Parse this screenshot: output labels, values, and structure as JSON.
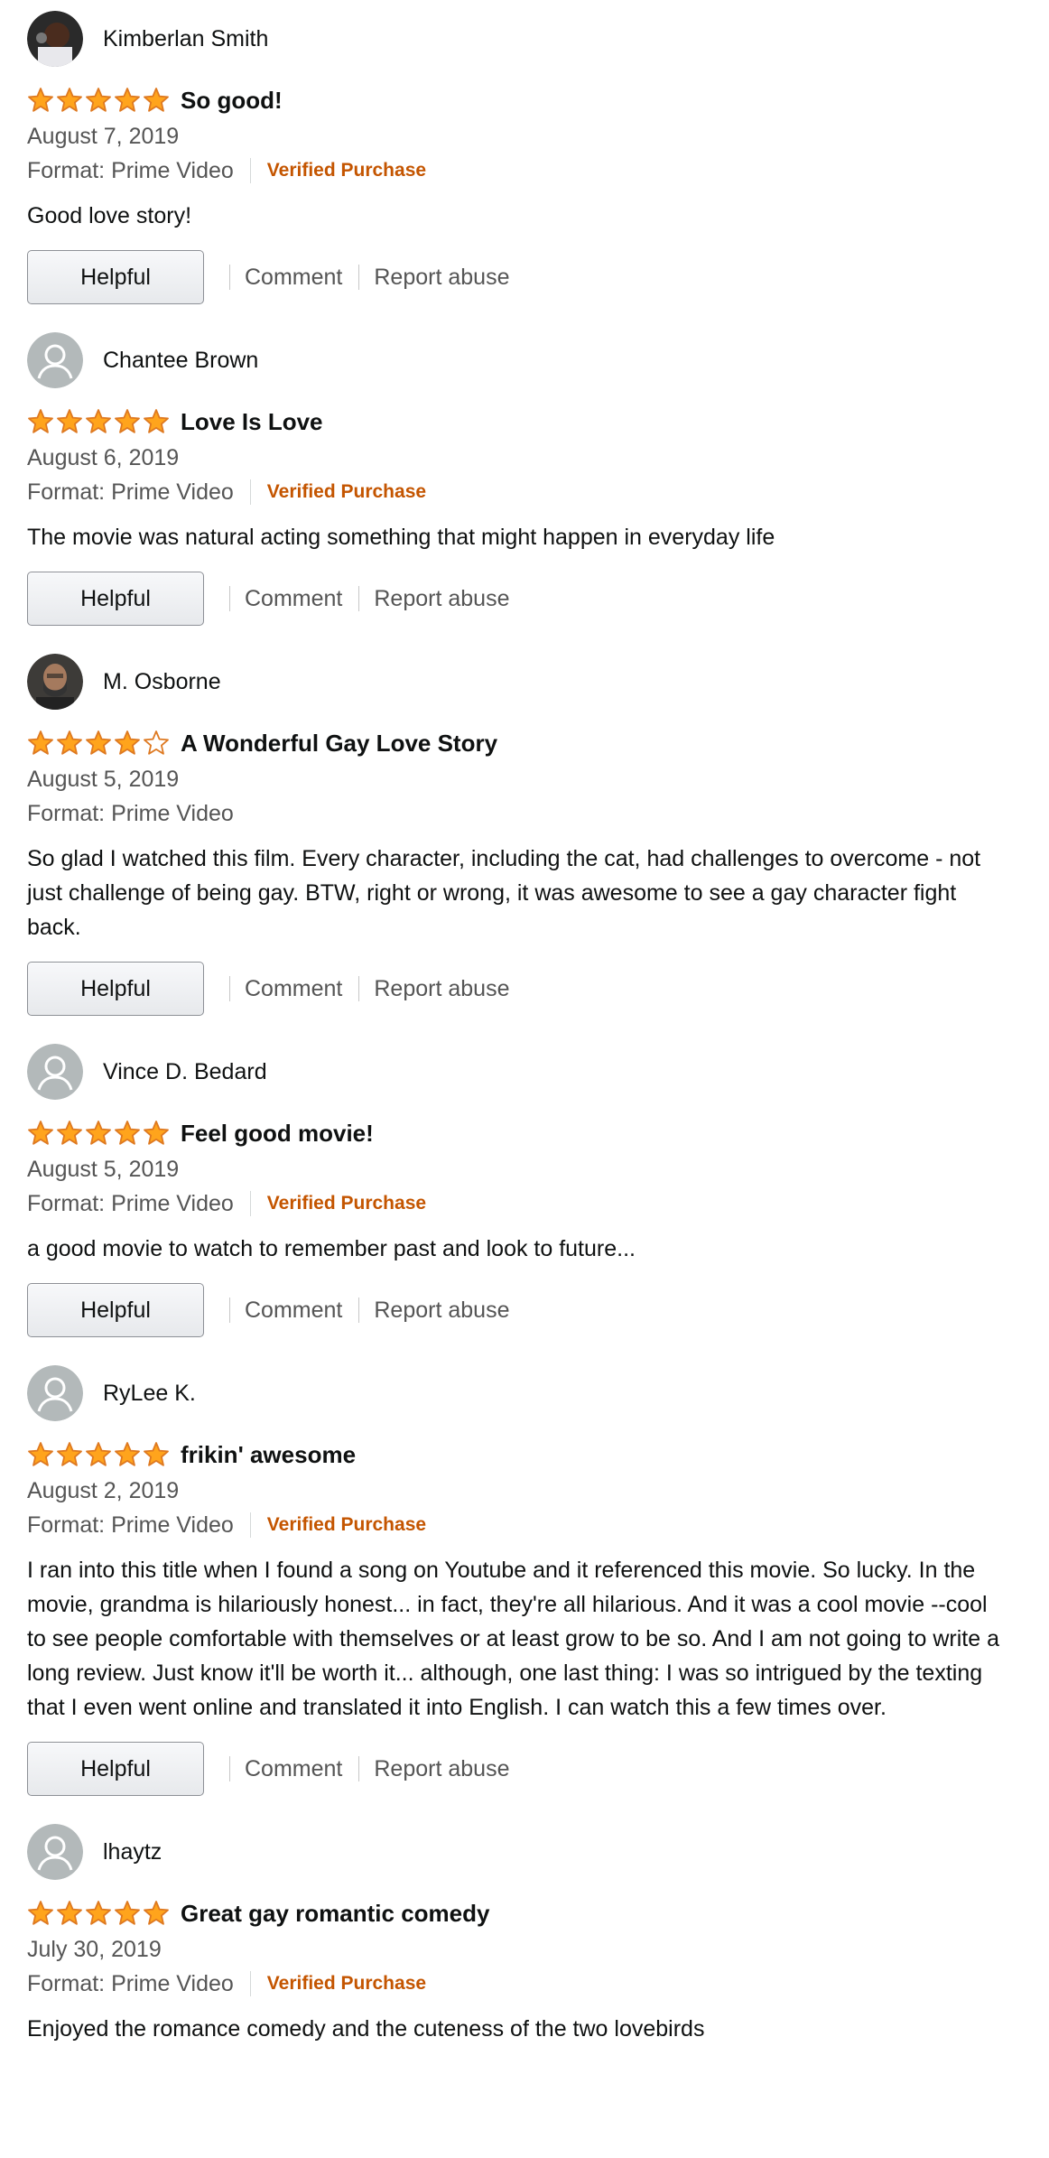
{
  "reviews": [
    {
      "author": "Kimberlan Smith",
      "avatar": "photo-dark",
      "rating": 5,
      "title": "So good!",
      "date": "August 7, 2019",
      "format": "Format: Prime Video",
      "verified": "Verified Purchase",
      "body": "Good love story!",
      "helpful": "Helpful",
      "comment": "Comment",
      "report": "Report abuse"
    },
    {
      "author": "Chantee Brown",
      "avatar": "default",
      "rating": 5,
      "title": "Love Is Love",
      "date": "August 6, 2019",
      "format": "Format: Prime Video",
      "verified": "Verified Purchase",
      "body": "The movie was natural acting something that might happen in everyday life",
      "helpful": "Helpful",
      "comment": "Comment",
      "report": "Report abuse"
    },
    {
      "author": "M. Osborne",
      "avatar": "photo-man",
      "rating": 4,
      "title": "A Wonderful Gay Love Story",
      "date": "August 5, 2019",
      "format": "Format: Prime Video",
      "verified": "",
      "body": "So glad I watched this film. Every character, including the cat, had challenges to overcome - not just challenge of being gay. BTW, right or wrong, it was awesome to see a gay character fight back.",
      "helpful": "Helpful",
      "comment": "Comment",
      "report": "Report abuse"
    },
    {
      "author": "Vince D. Bedard",
      "avatar": "default",
      "rating": 5,
      "title": "Feel good movie!",
      "date": "August 5, 2019",
      "format": "Format: Prime Video",
      "verified": "Verified Purchase",
      "body": "a good movie to watch to remember past and look to future...",
      "helpful": "Helpful",
      "comment": "Comment",
      "report": "Report abuse"
    },
    {
      "author": "RyLee K.",
      "avatar": "default",
      "rating": 5,
      "title": "frikin' awesome",
      "date": "August 2, 2019",
      "format": "Format: Prime Video",
      "verified": "Verified Purchase",
      "body": "I ran into this title when I found a song on Youtube and it referenced this movie. So lucky. In the movie, grandma is hilariously honest... in fact, they're all hilarious. And it was a cool movie --cool to see people comfortable with themselves or at least grow to be so. And I am not going to write a long review. Just know it'll be worth it... although, one last thing: I was so intrigued by the texting that I even went online and translated it into English. I can watch this a few times over.",
      "helpful": "Helpful",
      "comment": "Comment",
      "report": "Report abuse"
    },
    {
      "author": "lhaytz",
      "avatar": "default",
      "rating": 5,
      "title": "Great gay romantic comedy",
      "date": "July 30, 2019",
      "format": "Format: Prime Video",
      "verified": "Verified Purchase",
      "body": "Enjoyed the romance comedy and the cuteness of the two lovebirds",
      "helpful": "",
      "comment": "",
      "report": ""
    }
  ],
  "colors": {
    "star_fill": "#ffa41c",
    "star_stroke": "#de7921",
    "verified": "#c45500"
  }
}
